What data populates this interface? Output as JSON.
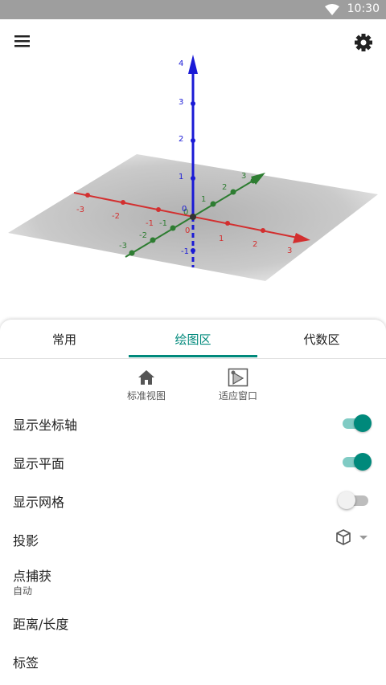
{
  "status_bar": {
    "time": "10:30"
  },
  "toolbar": {
    "menu_icon": "menu-icon",
    "settings_icon": "gear-icon"
  },
  "graphics": {
    "z_ticks": [
      "1",
      "2",
      "3",
      "4"
    ],
    "z_neg_tick": "-1",
    "x_ticks_pos": [
      "1",
      "2",
      "3"
    ],
    "x_ticks_neg": [
      "-1",
      "-2",
      "-3"
    ],
    "y_ticks_pos": [
      "1",
      "2",
      "3"
    ],
    "y_ticks_neg": [
      "-1",
      "-2",
      "-3"
    ],
    "origin_x": "0",
    "origin_y": "0",
    "origin_z": "0",
    "colors": {
      "x_axis": "#d32f2f",
      "y_axis": "#2e7d32",
      "z_axis": "#1a1ad6",
      "plane": "#9e9e9e"
    }
  },
  "tabs": [
    {
      "label": "常用"
    },
    {
      "label": "绘图区"
    },
    {
      "label": "代数区"
    }
  ],
  "active_tab": "绘图区",
  "quick_actions": [
    {
      "label": "标准视图",
      "icon": "home-icon"
    },
    {
      "label": "适应窗口",
      "icon": "fit-window-icon"
    }
  ],
  "settings": [
    {
      "label": "显示坐标轴",
      "type": "switch",
      "on": true
    },
    {
      "label": "显示平面",
      "type": "switch",
      "on": true
    },
    {
      "label": "显示网格",
      "type": "switch",
      "on": false
    },
    {
      "label": "投影",
      "type": "select",
      "icon": "cube-icon"
    },
    {
      "label": "点捕获",
      "sub": "自动"
    },
    {
      "label": "距离/长度"
    },
    {
      "label": "标签"
    }
  ],
  "accent_color": "#00897b"
}
